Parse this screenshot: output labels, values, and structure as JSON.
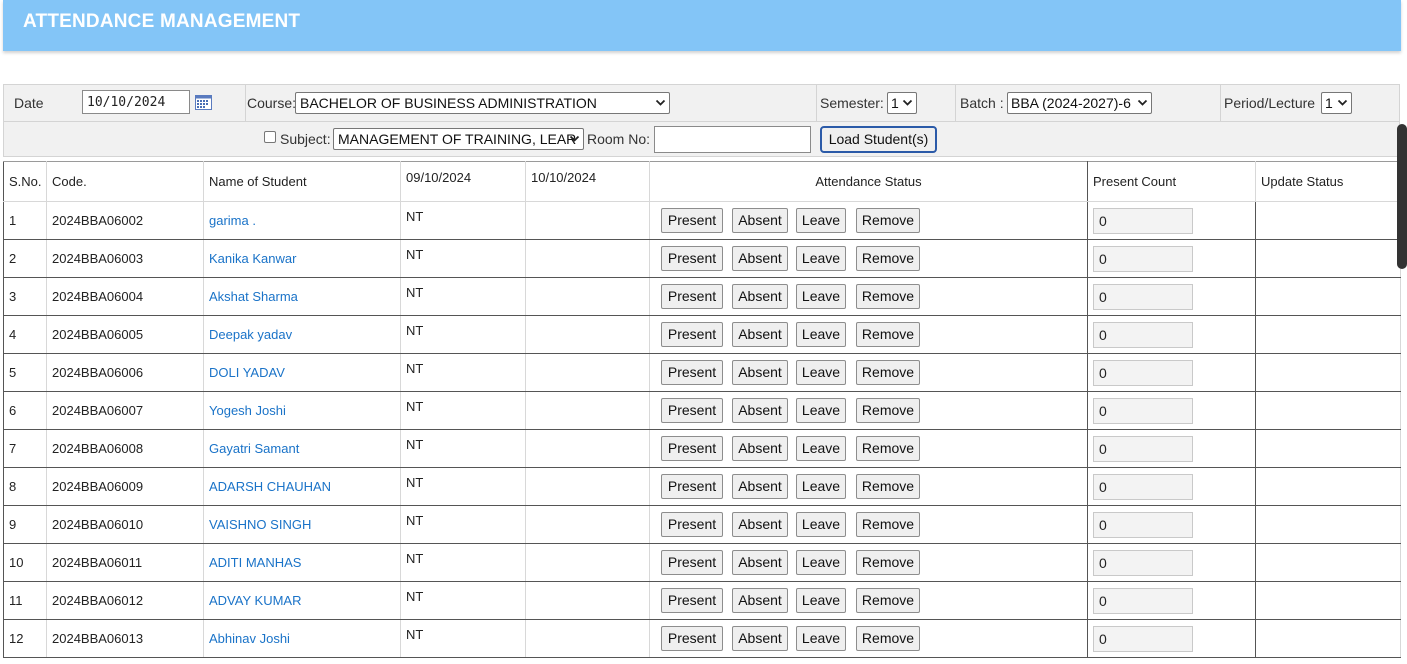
{
  "header": {
    "title": "ATTENDANCE MANAGEMENT"
  },
  "filters": {
    "date_label": "Date",
    "date_value": "10/10/2024",
    "course_label": "Course:",
    "course_value": "BACHELOR OF BUSINESS ADMINISTRATION",
    "semester_label": "Semester:",
    "semester_value": "1",
    "batch_label": "Batch :",
    "batch_value": "BBA (2024-2027)-6",
    "period_label": "Period/Lecture",
    "period_value": "1",
    "subject_label": "Subject:",
    "subject_value": "MANAGEMENT OF TRAINING, LEAR",
    "room_label": "Room No:",
    "room_value": "",
    "load_button": "Load Student(s)"
  },
  "table": {
    "headers": {
      "sno": "S.No.",
      "code": "Code.",
      "name": "Name of Student",
      "date1": "09/10/2024",
      "date2": "10/10/2024",
      "attendance": "Attendance Status",
      "present_count": "Present Count",
      "update_status": "Update Status"
    },
    "buttons": {
      "present": "Present",
      "absent": "Absent",
      "leave": "Leave",
      "remove": "Remove"
    },
    "rows": [
      {
        "sno": "1",
        "code": "2024BBA06002",
        "name": "garima .",
        "d1": "NT",
        "d2": "",
        "count": "0",
        "update": ""
      },
      {
        "sno": "2",
        "code": "2024BBA06003",
        "name": "Kanika Kanwar",
        "d1": "NT",
        "d2": "",
        "count": "0",
        "update": ""
      },
      {
        "sno": "3",
        "code": "2024BBA06004",
        "name": "Akshat Sharma",
        "d1": "NT",
        "d2": "",
        "count": "0",
        "update": ""
      },
      {
        "sno": "4",
        "code": "2024BBA06005",
        "name": "Deepak yadav",
        "d1": "NT",
        "d2": "",
        "count": "0",
        "update": ""
      },
      {
        "sno": "5",
        "code": "2024BBA06006",
        "name": "DOLI YADAV",
        "d1": "NT",
        "d2": "",
        "count": "0",
        "update": ""
      },
      {
        "sno": "6",
        "code": "2024BBA06007",
        "name": "Yogesh Joshi",
        "d1": "NT",
        "d2": "",
        "count": "0",
        "update": ""
      },
      {
        "sno": "7",
        "code": "2024BBA06008",
        "name": "Gayatri Samant",
        "d1": "NT",
        "d2": "",
        "count": "0",
        "update": ""
      },
      {
        "sno": "8",
        "code": "2024BBA06009",
        "name": "ADARSH CHAUHAN",
        "d1": "NT",
        "d2": "",
        "count": "0",
        "update": ""
      },
      {
        "sno": "9",
        "code": "2024BBA06010",
        "name": "VAISHNO SINGH",
        "d1": "NT",
        "d2": "",
        "count": "0",
        "update": ""
      },
      {
        "sno": "10",
        "code": "2024BBA06011",
        "name": "ADITI MANHAS",
        "d1": "NT",
        "d2": "",
        "count": "0",
        "update": ""
      },
      {
        "sno": "11",
        "code": "2024BBA06012",
        "name": "ADVAY KUMAR",
        "d1": "NT",
        "d2": "",
        "count": "0",
        "update": ""
      },
      {
        "sno": "12",
        "code": "2024BBA06013",
        "name": "Abhinav Joshi",
        "d1": "NT",
        "d2": "",
        "count": "0",
        "update": ""
      }
    ]
  },
  "icons": {
    "calendar": "calendar-icon",
    "dropdown": "chevron-down-icon"
  },
  "colors": {
    "header_bg": "#83c5f7",
    "link": "#1a73c8",
    "button_border_focus": "#2b5aa8"
  }
}
